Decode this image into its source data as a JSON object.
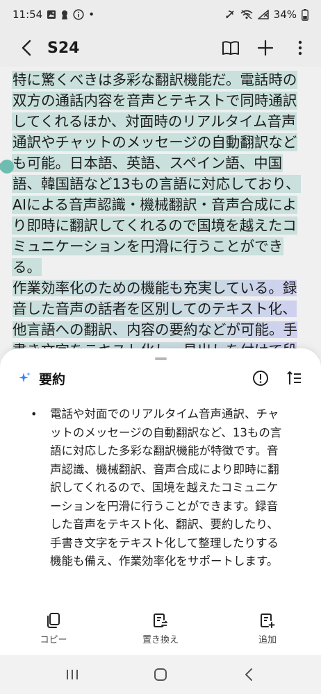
{
  "status_bar": {
    "time": "11:54",
    "dot": "•",
    "battery": "34%",
    "icons": [
      "gallery-icon",
      "keyhole-icon",
      "info-icon",
      "dnd-slash-icon",
      "wifi-icon",
      "signal-icon",
      "battery-icon"
    ]
  },
  "app_bar": {
    "title": "S24",
    "actions": [
      "book-icon",
      "plus-icon",
      "more-icon"
    ]
  },
  "note": {
    "paragraph1": "特に驚くべきは多彩な翻訳機能だ。電話時の双方の通話内容を音声とテキストで同時通訳してくれるほか、対面時のリアルタイム音声通訳やチャットのメッセージの自動翻訳なども可能。日本語、英語、スペイン語、中国語、韓国語など13もの言語に対応しており、AIによる音声認識・機械翻訳・音声合成により即時に翻訳してくれるので国境を越えたコミュニケーションを円滑に行うことができる。",
    "paragraph2": "作業効率化のための機能も充実している。録音した音声の話者を区別してのテキスト化、他言語への翻訳、内容の要約などが可能。手書き文字をテキスト化し、見出しを付けて段"
  },
  "summary_sheet": {
    "title": "要約",
    "bullet": "•",
    "text": "電話や対面でのリアルタイム音声通訳、チャットのメッセージの自動翻訳など、13もの言語に対応した多彩な翻訳機能が特徴です。音声認識、機械翻訳、音声合成により即時に翻訳してくれるので、国境を越えたコミュニケーションを円滑に行うことができます。録音した音声をテキスト化、翻訳、要約したり、手書き文字をテキスト化して整理したりする機能も備え、作業効率化をサポートします。",
    "actions": [
      {
        "label": "コピー",
        "icon": "copy-icon"
      },
      {
        "label": "置き換え",
        "icon": "replace-icon"
      },
      {
        "label": "追加",
        "icon": "add-note-icon"
      }
    ]
  },
  "colors": {
    "highlight": "#c9e0dc",
    "accent_purple": "#8f86e6",
    "handle": "#6fbdb0",
    "sparkle_blue": "#3b82f6"
  }
}
